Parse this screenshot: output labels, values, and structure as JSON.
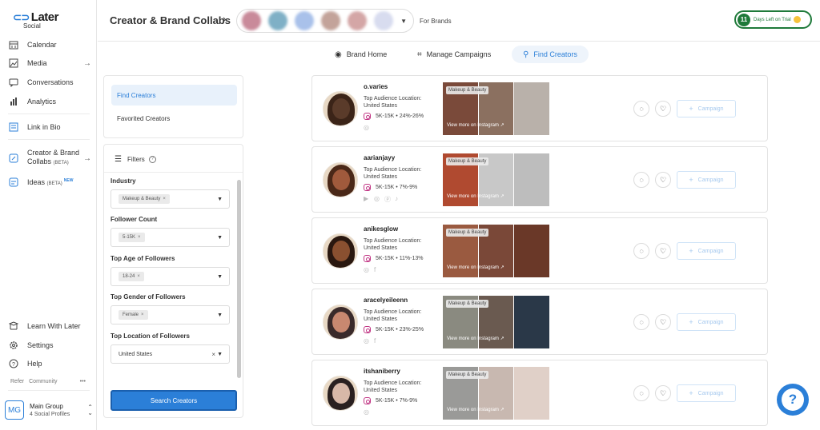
{
  "app": {
    "logo": "Later",
    "logo_sub": "Social"
  },
  "sidebar": {
    "items": [
      {
        "label": "Calendar",
        "icon": "calendar-icon"
      },
      {
        "label": "Media",
        "icon": "image-icon",
        "arrow": "→"
      },
      {
        "label": "Conversations",
        "icon": "chat-bubble-icon"
      },
      {
        "label": "Analytics",
        "icon": "bar-chart-icon"
      },
      {
        "label": "Link in Bio",
        "icon": "link-in-bio-icon"
      },
      {
        "label": "Creator & Brand",
        "label2": "Collabs",
        "badge": "(BETA)",
        "icon": "collab-icon",
        "arrow": "→"
      },
      {
        "label": "Ideas",
        "badge": "(BETA)",
        "new_badge": "NEW",
        "icon": "ideas-icon"
      }
    ],
    "bottom_items": [
      {
        "label": "Learn With Later",
        "icon": "learn-icon"
      },
      {
        "label": "Settings",
        "icon": "gear-icon"
      },
      {
        "label": "Help",
        "icon": "help-icon"
      }
    ],
    "refer": "Refer",
    "community": "Community",
    "more": "•••",
    "group": {
      "initials": "MG",
      "name": "Main Group",
      "profiles": "4 Social Profiles"
    }
  },
  "header": {
    "title": "Creator & Brand Collabs",
    "for_brands": "For Brands",
    "trial": {
      "days": "11",
      "text": "Days Left on Trial"
    },
    "brand_avatar_colors": [
      "#c98a9a",
      "#7fb0c6",
      "#a9c1ea",
      "#c3a39a",
      "#d4a6a6",
      "#d8dcef"
    ]
  },
  "tabs": [
    {
      "label": "Brand Home",
      "icon": "home-icon"
    },
    {
      "label": "Manage Campaigns",
      "icon": "campaigns-icon"
    },
    {
      "label": "Find Creators",
      "icon": "find-creators-icon"
    }
  ],
  "finder_menu": {
    "find": "Find Creators",
    "favorited": "Favorited Creators"
  },
  "filters": {
    "title": "Filters",
    "industry": {
      "label": "Industry",
      "value": "Makeup & Beauty"
    },
    "follower_count": {
      "label": "Follower Count",
      "value": "5-15K"
    },
    "top_age": {
      "label": "Top Age of Followers",
      "value": "18-24"
    },
    "top_gender": {
      "label": "Top Gender of Followers",
      "value": "Female"
    },
    "top_location": {
      "label": "Top Location of Followers",
      "value": "United States"
    },
    "search_button": "Search Creators"
  },
  "creators": [
    {
      "name": "o.varies",
      "loc_label": "Top Audience Location:",
      "loc": "United States",
      "stats": "5K-15K • 24%-26%",
      "tag": "Makeup & Beauty",
      "more": "View more on Instagram ↗",
      "avatar_colors": [
        "#5a3b2a",
        "#3b2418"
      ],
      "thumbs": [
        "#7a4a3a",
        "#8b7060",
        "#b9b1aa"
      ],
      "socials": [
        "◎"
      ]
    },
    {
      "name": "aarianjayy",
      "loc_label": "Top Audience Location:",
      "loc": "United States",
      "stats": "5K-15K • 7%-9%",
      "tag": "Makeup & Beauty",
      "more": "View more on Instagram ↗",
      "avatar_colors": [
        "#a05a3c",
        "#4a2818"
      ],
      "thumbs": [
        "#b04a30",
        "#c8c8c8",
        "#bdbdbd"
      ],
      "socials": [
        "▶",
        "◎",
        "ⓟ",
        "♪"
      ]
    },
    {
      "name": "anikesglow",
      "loc_label": "Top Audience Location:",
      "loc": "United States",
      "stats": "5K-15K • 11%-13%",
      "tag": "Makeup & Beauty",
      "more": "View more on Instagram ↗",
      "avatar_colors": [
        "#8a5030",
        "#2a1810"
      ],
      "thumbs": [
        "#9a5a40",
        "#7a4838",
        "#6a3828"
      ],
      "socials": [
        "◎",
        "f"
      ]
    },
    {
      "name": "aracelyeileenn",
      "loc_label": "Top Audience Location:",
      "loc": "United States",
      "stats": "5K-15K • 23%-25%",
      "tag": "Makeup & Beauty",
      "more": "View more on Instagram ↗",
      "avatar_colors": [
        "#c88870",
        "#3a2a2a"
      ],
      "thumbs": [
        "#8a8a80",
        "#6a5a50",
        "#2a3848"
      ],
      "socials": [
        "◎",
        "f"
      ]
    },
    {
      "name": "itshaniberry",
      "loc_label": "Top Audience Location:",
      "loc": "United States",
      "stats": "5K-15K • 7%-9%",
      "tag": "Makeup & Beauty",
      "more": "View more on Instagram ↗",
      "avatar_colors": [
        "#d8b8a8",
        "#2a2020"
      ],
      "thumbs": [
        "#9a9a98",
        "#c8b8b0",
        "#e0d0c8"
      ],
      "socials": [
        "◎"
      ]
    }
  ],
  "campaign_label": "Campaign",
  "help_label": "?"
}
